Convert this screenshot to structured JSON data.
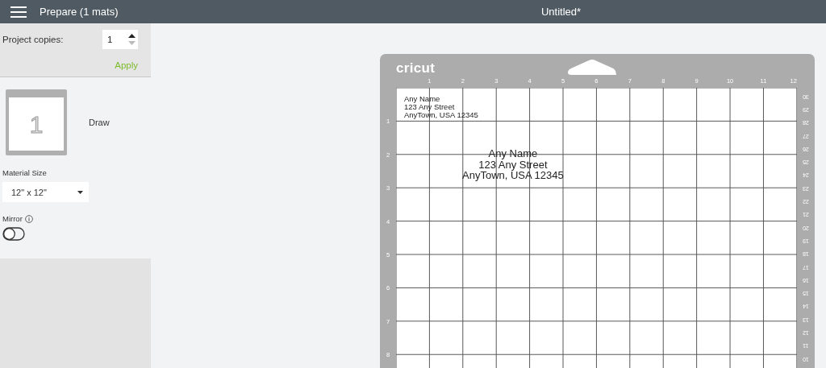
{
  "header": {
    "panel_title": "Prepare (1 mats)",
    "document_title": "Untitled*"
  },
  "copies": {
    "label": "Project copies:",
    "value": "1",
    "apply": "Apply"
  },
  "mats": [
    {
      "thumbnail_label": "1",
      "mode": "Draw"
    }
  ],
  "material_size": {
    "label": "Material Size",
    "value": "12\" x 12\""
  },
  "mirror": {
    "label": "Mirror",
    "on": false
  },
  "mat": {
    "logo": "cricut",
    "top_ruler": [
      "1",
      "2",
      "3",
      "4",
      "5",
      "6",
      "7",
      "8",
      "9",
      "10",
      "11",
      "12"
    ],
    "left_ruler": [
      "1",
      "2",
      "3",
      "4",
      "5",
      "6",
      "7",
      "8"
    ],
    "right_ruler": [
      "30",
      "29",
      "28",
      "27",
      "26",
      "25",
      "24",
      "23",
      "22",
      "21",
      "20",
      "19",
      "18",
      "17",
      "16",
      "15",
      "14",
      "13",
      "12",
      "11",
      "10"
    ],
    "texts": [
      {
        "lines": [
          "Any Name",
          "123 Any Street",
          "AnyTown, USA 12345"
        ]
      },
      {
        "lines": [
          "Any Name",
          "123 Any Street",
          "AnyTown, USA 12345"
        ]
      }
    ]
  }
}
